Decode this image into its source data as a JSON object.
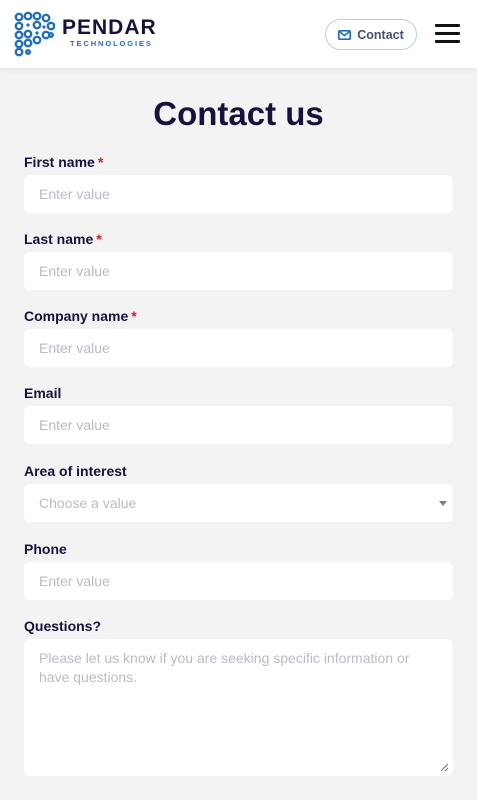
{
  "header": {
    "brand_name": "PENDAR",
    "brand_sub": "TECHNOLOGIES",
    "contact_label": "Contact",
    "brand_color": "#1f6fbf"
  },
  "page": {
    "title": "Contact us"
  },
  "form": {
    "required_marker": "*",
    "first_name": {
      "label": "First name",
      "placeholder": "Enter value",
      "required": true
    },
    "last_name": {
      "label": "Last name",
      "placeholder": "Enter value",
      "required": true
    },
    "company_name": {
      "label": "Company name",
      "placeholder": "Enter value",
      "required": true
    },
    "email": {
      "label": "Email",
      "placeholder": "Enter value",
      "required": false
    },
    "area_of_interest": {
      "label": "Area of interest",
      "placeholder": "Choose a value",
      "required": false
    },
    "phone": {
      "label": "Phone",
      "placeholder": "Enter value",
      "required": false
    },
    "questions": {
      "label": "Questions?",
      "placeholder": "Please let us know if you are seeking specific information or have questions.",
      "required": false
    }
  },
  "icons": {
    "logo": "pendar-logo-icon",
    "contact": "mail-icon",
    "menu": "hamburger-menu-icon",
    "select": "chevron-down-icon",
    "resize": "resize-handle-icon"
  }
}
